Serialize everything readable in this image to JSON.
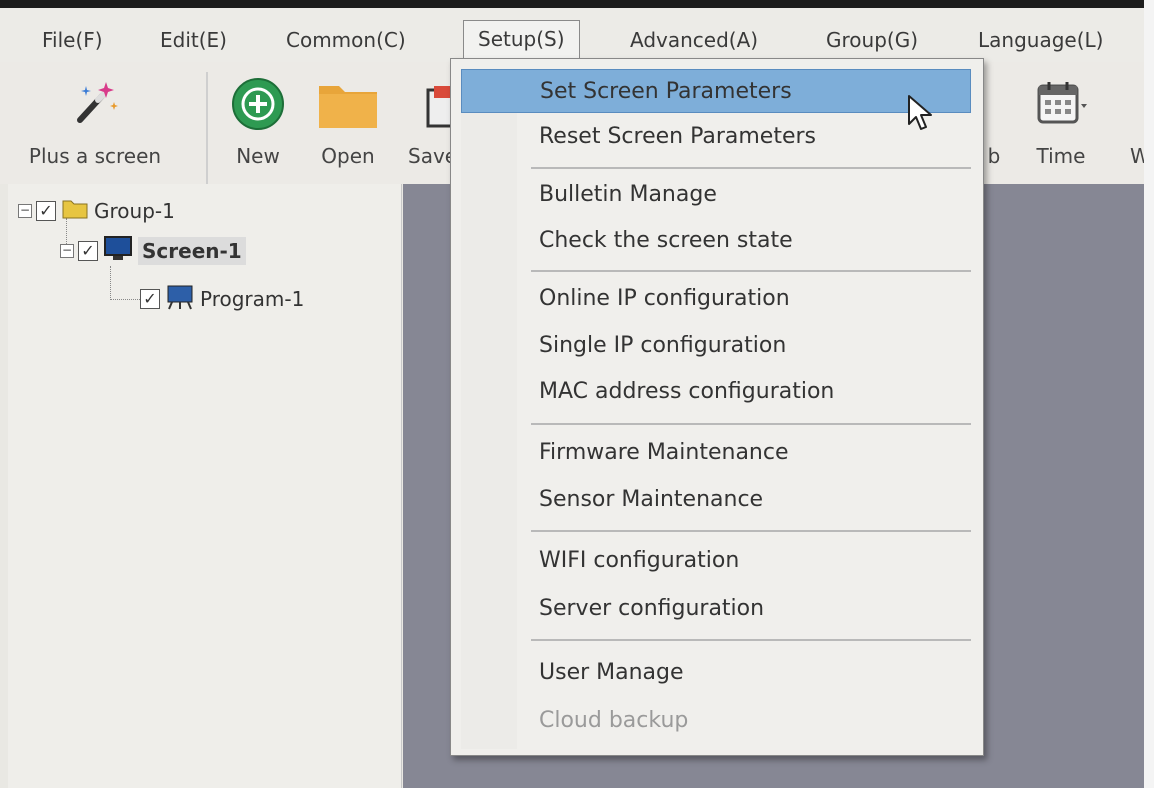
{
  "menubar": {
    "items": [
      "File(F)",
      "Edit(E)",
      "Common(C)",
      "Setup(S)",
      "Advanced(A)",
      "Group(G)",
      "Language(L)"
    ]
  },
  "toolbar": {
    "plus_screen": "Plus a screen",
    "new": "New",
    "open": "Open",
    "save": "Save",
    "clock_partial": "b",
    "time": "Time",
    "cut_off": "W"
  },
  "tree": {
    "group": "Group-1",
    "screen": "Screen-1",
    "program": "Program-1"
  },
  "setup_menu": {
    "items": [
      {
        "label": "Set Screen Parameters"
      },
      {
        "label": "Reset Screen Parameters"
      },
      {
        "label": "Bulletin Manage"
      },
      {
        "label": "Check the screen state"
      },
      {
        "label": "Online IP configuration"
      },
      {
        "label": "Single IP configuration"
      },
      {
        "label": "MAC address configuration"
      },
      {
        "label": "Firmware Maintenance"
      },
      {
        "label": "Sensor Maintenance"
      },
      {
        "label": "WIFI configuration"
      },
      {
        "label": "Server configuration"
      },
      {
        "label": "User Manage"
      },
      {
        "label": "Cloud backup"
      }
    ]
  },
  "colors": {
    "highlight": "#7eaed9",
    "work_area": "#868794",
    "new_button": "#2e9a52",
    "folder": "#e8a53a"
  }
}
